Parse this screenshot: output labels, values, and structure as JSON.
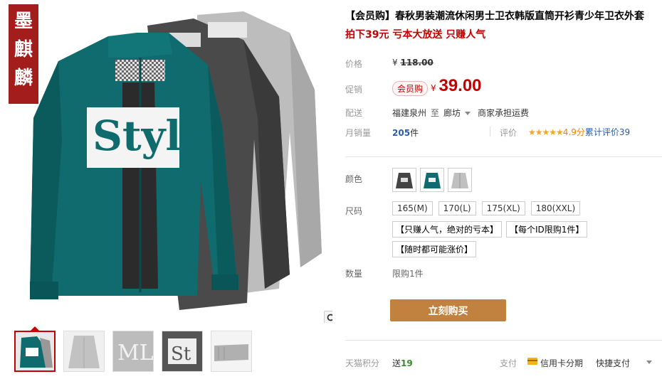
{
  "brand_flag": "墨麒麟",
  "gallery": {
    "thumb_count": 5,
    "active_thumb": 0
  },
  "product": {
    "title": "【会员购】春秋男装潮流休闲男士卫衣韩版直筒开衫青少年卫衣外套",
    "subtitle": "拍下39元 亏本大放送 只赚人气"
  },
  "price": {
    "label": "价格",
    "currency": "¥",
    "original": "118.00"
  },
  "promo": {
    "label": "促销",
    "badge": "会员购",
    "currency": "¥",
    "price": "39.00"
  },
  "shipping": {
    "label": "配送",
    "origin": "福建泉州",
    "to": "至",
    "destination": "廊坊",
    "note": "商家承担运费"
  },
  "sales": {
    "label": "月销量",
    "count": "205",
    "unit": "件"
  },
  "reviews": {
    "label": "评价",
    "stars": "★★★★★",
    "score": "4.9分",
    "text": "累计评价",
    "count": "39"
  },
  "color": {
    "label": "颜色",
    "options": [
      "深灰",
      "墨绿",
      "浅灰"
    ]
  },
  "size": {
    "label": "尺码",
    "options": [
      "165(M)",
      "170(L)",
      "175(XL)",
      "180(XXL)"
    ]
  },
  "notes": [
    "【只赚人气，绝对的亏本】",
    "【每个ID限购1件】",
    "【随时都可能涨价】"
  ],
  "quantity": {
    "label": "数量",
    "limit": "限购1件"
  },
  "buy_button": "立刻购买",
  "points": {
    "label": "天猫积分",
    "text": "送",
    "value": "19"
  },
  "payment": {
    "label": "支付",
    "method1": "信用卡分期",
    "method2": "快捷支付"
  },
  "colors": {
    "accent": "#c40000",
    "buy": "#c0823e",
    "teal": "#0f6b6e",
    "link": "#2a5da8"
  }
}
